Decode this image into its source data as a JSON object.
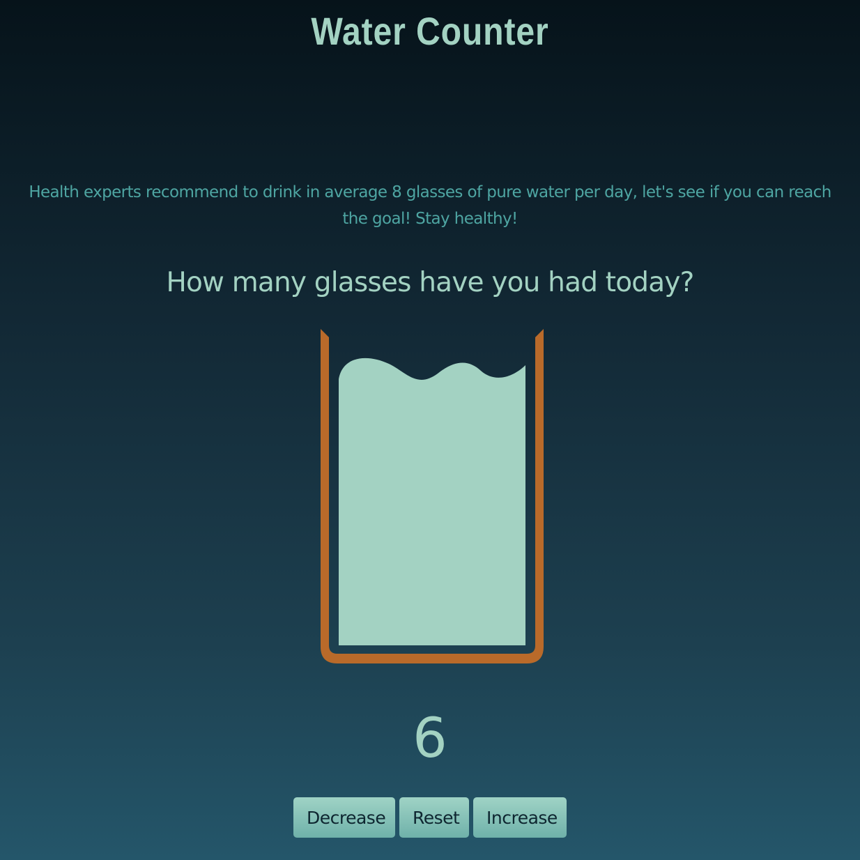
{
  "header": {
    "title": "Water Counter"
  },
  "intro": {
    "text": "Health experts recommend to drink in average 8 glasses of pure water per day, let's see if you can reach the goal! Stay healthy!"
  },
  "question": "How many glasses have you had today?",
  "counter": {
    "value": "6",
    "goal": 8
  },
  "glass": {
    "fill_fraction": 0.75,
    "frame_color": "#b96a2a",
    "water_color": "#a3d2c2"
  },
  "buttons": {
    "decrease_label": "Decrease",
    "reset_label": "Reset",
    "increase_label": "Increase"
  },
  "colors": {
    "background_top": "#06131a",
    "background_bottom": "#24566a",
    "accent": "#a3d2c2",
    "intro_text": "#4ea5a2"
  }
}
